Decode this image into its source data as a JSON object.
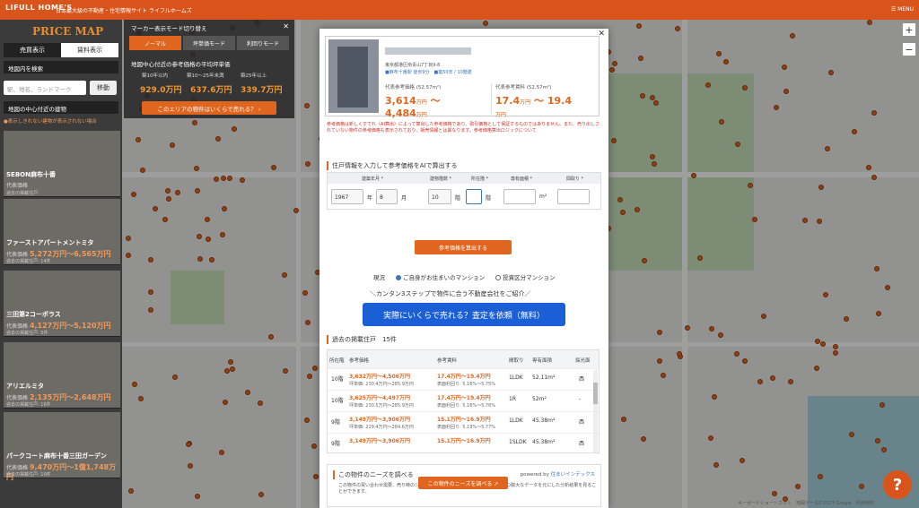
{
  "header": {
    "logo": "LIFULL HOME'S",
    "tagline": "日本最大級の不動産・住宅情報サイト ライフルホームズ",
    "menu": "☰ MENU"
  },
  "sidebar": {
    "title": "PRICE MAP",
    "tabs": [
      "売買表示",
      "賃料表示"
    ],
    "search_label": "地図内を検索",
    "search_placeholder": "駅、地名、ランドマーク",
    "move_button": "移動",
    "center_label": "地図の中心付近の建物",
    "hidden_note": "●表示しきれない建物が表示されない場合",
    "cards": [
      {
        "name": "SEBON麻布十番",
        "price_label": "代表価格",
        "price": "",
        "past": "過去の掲載住戸: "
      },
      {
        "name": "ファーストアパートメントミタ",
        "price_label": "代表価格",
        "price": "5,272万円〜6,565万円",
        "past": "過去の掲載住戸: 14件"
      },
      {
        "name": "三田第2コーポラス",
        "price_label": "代表価格",
        "price": "4,127万円〜5,120万円",
        "past": "過去の掲載住戸: 5件"
      },
      {
        "name": "アリエルミタ",
        "price_label": "代表価格",
        "price": "2,135万円〜2,648万円",
        "past": "過去の掲載住戸: 16件"
      },
      {
        "name": "パークコート麻布十番三田ガーデン",
        "price_label": "代表価格",
        "price": "9,470万円〜1億1,748万円",
        "past": "過去の掲載住戸: 10件"
      }
    ]
  },
  "map_control": {
    "title": "マーカー表示モード切り替え",
    "modes": [
      "ノーマル",
      "坪単価モード",
      "利回りモード"
    ],
    "subtitle": "地図中心付近の参考価格の平均坪単価",
    "years": [
      "築10年以内",
      "築10〜25年未満",
      "築25年以上"
    ],
    "values": [
      "929.0万円",
      "637.6万円",
      "339.7万円"
    ],
    "cta": "このエリアの物件はいくらで売れる？ ›"
  },
  "modal": {
    "address": "東京都港区南青山7丁目9-8",
    "lines": "■麻布十番駅 徒歩9分　■築50年 / 10階建",
    "price_label": "代表参考価格 (52.57m²)",
    "price_low": "3,614",
    "price_high": "4,484",
    "unit": "万円",
    "rent_label": "代表参考賃料 (52.57m²)",
    "rent_low": "17.4",
    "rent_high": "19.4",
    "warning": "参考価格は新しくすでれ（AI算出）によって算出した参考価格であり、取引価格として保証するものではありません。また、売り出しされていない物件の参考価格も表示されており、販売情報とは異なります。参考価格算出ロジックについて",
    "form_title": "住戸情報を入力して参考価格をAIで算出する",
    "form_headers": [
      "建築年月 *",
      "建物階数 *",
      "所在階 *",
      "専有面積 *",
      "間取り *"
    ],
    "year": "1967",
    "month": "8",
    "floors": "10",
    "year_unit": "年",
    "month_unit": "月",
    "floor_unit": "階",
    "area_unit": "m²",
    "calc_button": "参考価格を算出する",
    "radio_label": "現況",
    "radio1": "ご自身がお住まいのマンション",
    "radio2": "投資区分マンション",
    "intro": "＼カンタン3ステップで物件に合う不動産会社をご紹介／",
    "cta": "実際にいくらで売れる？査定を依頼（無料）",
    "past_title": "過去の掲載住戸",
    "past_count": "15件",
    "table_headers": [
      "所在階",
      "参考価格",
      "参考賃料",
      "間取り",
      "専有面積",
      "採光面"
    ],
    "rows": [
      {
        "floor": "10階",
        "price": "3,632万円〜4,506万円",
        "price_sub": "坪単価: 230.4万円〜285.9万円",
        "rent": "17.4万円〜19.4万円",
        "rent_sub": "表面利回り: 5.16%〜5.75%",
        "layout": "1LDK",
        "area": "52.11m²",
        "dir": "西"
      },
      {
        "floor": "10階",
        "price": "3,625万円〜4,497万円",
        "price_sub": "坪単価: 230.5万円〜285.9万円",
        "rent": "17.4万円〜19.4万円",
        "rent_sub": "表面利回り: 5.16%〜5.76%",
        "layout": "1R",
        "area": "52m²",
        "dir": "-"
      },
      {
        "floor": "9階",
        "price": "3,149万円〜3,906万円",
        "price_sub": "坪単価: 229.4万円〜284.6万円",
        "rent": "15.1万円〜16.9万円",
        "rent_sub": "表面利回り: 5.19%〜5.77%",
        "layout": "1LDK",
        "area": "45.38m²",
        "dir": "西"
      },
      {
        "floor": "9階",
        "price": "3,149万円〜3,906万円",
        "price_sub": "",
        "rent": "15.1万円〜16.9万円",
        "rent_sub": "",
        "layout": "1SLDK",
        "area": "45.38m²",
        "dir": "西"
      }
    ],
    "needs_title": "この物件のニーズを調べる",
    "powered": "powered by",
    "powered_brand": "住まいインデックス",
    "needs_desc": "この物件の買い合わせ需要、売り時のシミュレーションなど、LIFULL HOME'Sが持つ膨大なデータを元にした分析結果を見ることができます。",
    "needs_button": "この物件のニーズを調べる ↗"
  },
  "credit": "キーボードショートカット　地図データ©2023 Google　利用規約"
}
